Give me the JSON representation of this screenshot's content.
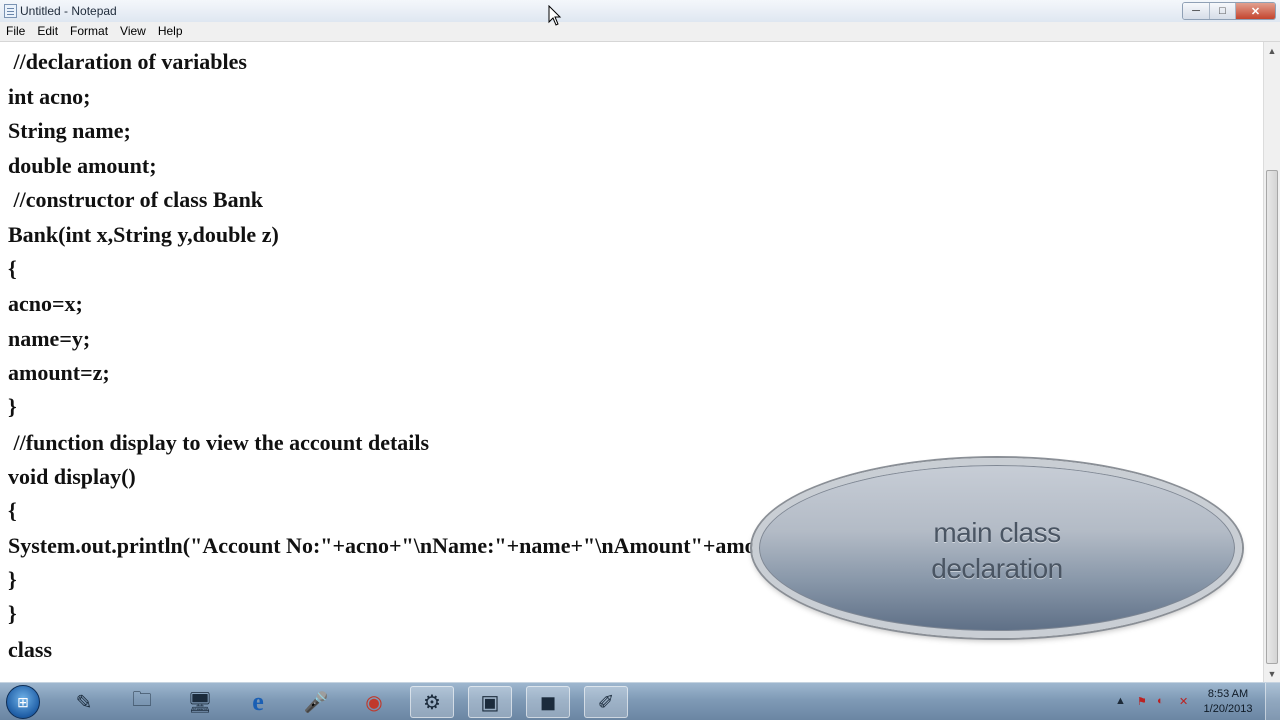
{
  "window": {
    "title": "Untitled - Notepad",
    "minimize": "─",
    "maximize": "□",
    "close": "✕"
  },
  "menu": [
    "File",
    "Edit",
    "Format",
    "View",
    "Help"
  ],
  "editor": {
    "lines": [
      " //declaration of variables",
      "int acno;",
      "String name;",
      "double amount;",
      " //constructor of class Bank",
      "Bank(int x,String y,double z)",
      "{",
      "acno=x;",
      "name=y;",
      "amount=z;",
      "}",
      " //function display to view the account details",
      "void display()",
      "{",
      "System.out.println(\"Account No:\"+acno+\"\\nName:\"+name+\"\\nAmount\"+amount);",
      "}",
      "}",
      "class"
    ]
  },
  "overlay": {
    "line1": "main class",
    "line2": "declaration"
  },
  "taskbar": {
    "start_glyph": "⊞",
    "icons": [
      {
        "name": "paint-icon",
        "glyph": "✎"
      },
      {
        "name": "file-explorer-icon",
        "glyph": "🗀"
      },
      {
        "name": "computer-icon",
        "glyph": "🖥"
      },
      {
        "name": "internet-explorer-icon",
        "glyph": "e"
      },
      {
        "name": "microphone-icon",
        "glyph": "🎤"
      },
      {
        "name": "chrome-icon",
        "glyph": "◉"
      },
      {
        "name": "tools-icon",
        "glyph": "⚙"
      },
      {
        "name": "package-icon",
        "glyph": "▣"
      },
      {
        "name": "camera-icon",
        "glyph": "◼"
      },
      {
        "name": "notepad-icon",
        "glyph": "✐"
      }
    ],
    "tray": {
      "expand": "▲",
      "time": "8:53 AM",
      "date": "1/20/2013"
    }
  }
}
